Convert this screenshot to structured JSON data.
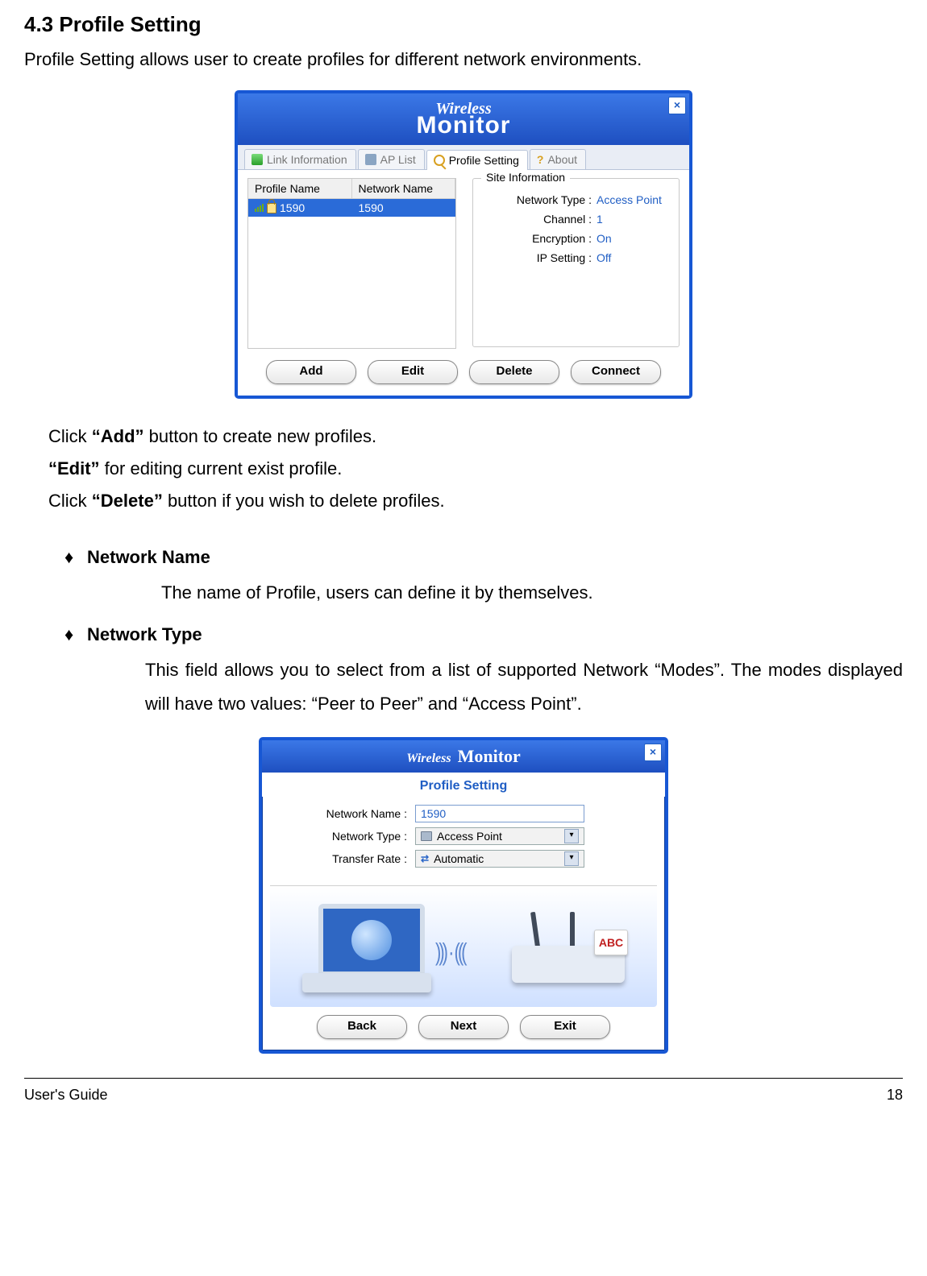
{
  "section": {
    "number": "4.3",
    "title": "4.3 Profile Setting",
    "intro": "Profile Setting allows user to create profiles for different network environments."
  },
  "window1": {
    "app_title_top": "Wireless",
    "app_title_bottom": "Monitor",
    "close_glyph": "×",
    "tabs": {
      "link_info": "Link Information",
      "ap_list": "AP List",
      "profile_setting": "Profile Setting",
      "about": "About"
    },
    "profile_list": {
      "col1": "Profile Name",
      "col2": "Network Name",
      "rows": [
        {
          "profile": "1590",
          "network": "1590",
          "selected": true
        }
      ]
    },
    "site_info": {
      "group_label": "Site Information",
      "network_type_label": "Network Type :",
      "network_type_value": "Access Point",
      "channel_label": "Channel :",
      "channel_value": "1",
      "encryption_label": "Encryption :",
      "encryption_value": "On",
      "ip_setting_label": "IP Setting :",
      "ip_setting_value": "Off"
    },
    "buttons": {
      "add": "Add",
      "edit": "Edit",
      "delete": "Delete",
      "connect": "Connect"
    }
  },
  "instructions": {
    "line1_a": "Click ",
    "line1_b": "“Add”",
    "line1_c": " button to create new profiles.",
    "line2_a": "“Edit”",
    "line2_b": " for editing current exist profile.",
    "line3_a": "Click ",
    "line3_b": "“Delete”",
    "line3_c": " button if you wish to delete profiles."
  },
  "bullets": {
    "diamond": "♦",
    "network_name_label": "Network Name",
    "network_name_desc": "The name of Profile, users can define it by themselves.",
    "network_type_label": "Network Type",
    "network_type_desc": "This field allows you to select from a list of supported Network “Modes”.  The modes displayed will have two values:  “Peer to Peer” and “Access Point”."
  },
  "window2": {
    "app_title_top": "Wireless",
    "app_title_bottom": "Monitor",
    "close_glyph": "×",
    "subtitle": "Profile Setting",
    "fields": {
      "network_name_label": "Network Name :",
      "network_name_value": "1590",
      "network_type_label": "Network Type :",
      "network_type_value": "Access Point",
      "transfer_rate_label": "Transfer Rate :",
      "transfer_rate_value": "Automatic"
    },
    "router_badge": "ABC",
    "buttons": {
      "back": "Back",
      "next": "Next",
      "exit": "Exit"
    }
  },
  "footer": {
    "guide": "User's Guide",
    "page": "18"
  }
}
